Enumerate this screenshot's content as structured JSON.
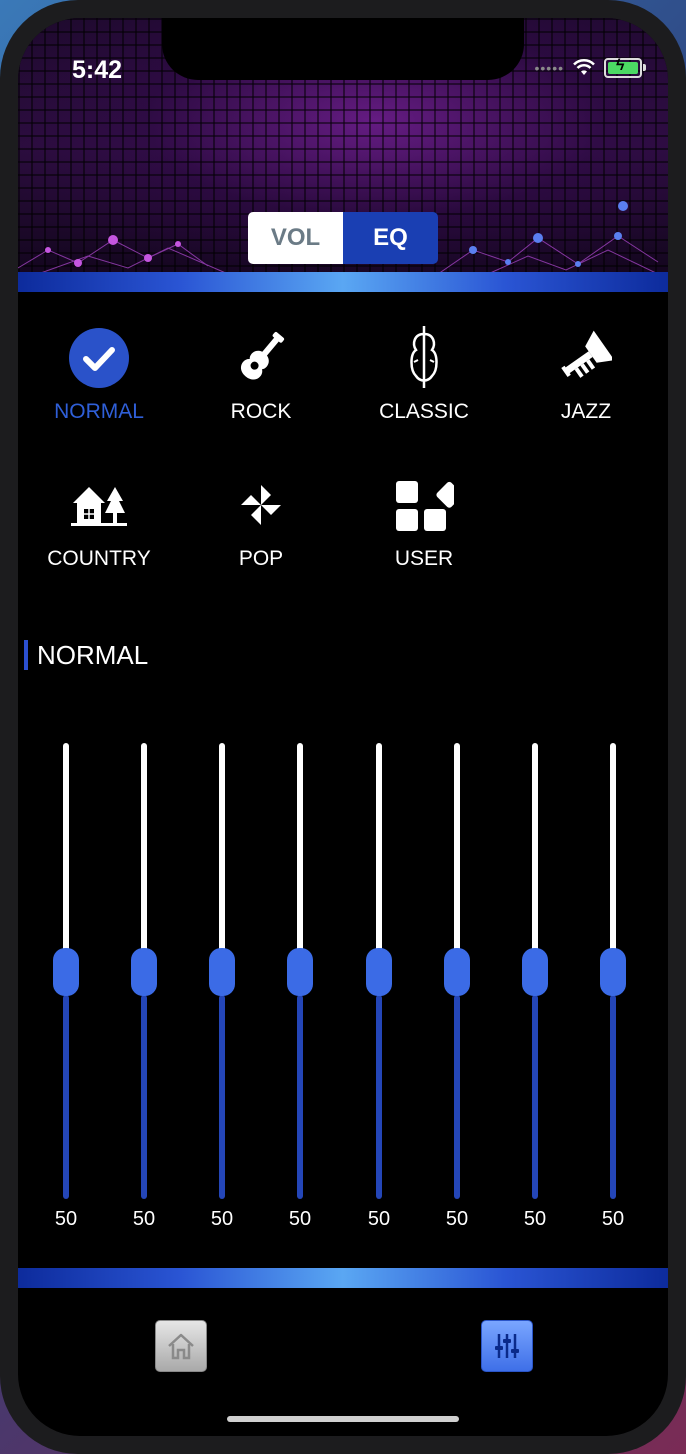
{
  "status": {
    "time": "5:42",
    "signal_dots": "•••••",
    "battery_color": "#4cd964"
  },
  "mode_switch": {
    "vol_label": "VOL",
    "eq_label": "EQ",
    "selected": "EQ"
  },
  "presets": [
    {
      "label": "NORMAL",
      "icon": "check-circle-icon",
      "selected": true
    },
    {
      "label": "ROCK",
      "icon": "guitar-icon",
      "selected": false
    },
    {
      "label": "CLASSIC",
      "icon": "violin-icon",
      "selected": false
    },
    {
      "label": "JAZZ",
      "icon": "trumpet-icon",
      "selected": false
    },
    {
      "label": "COUNTRY",
      "icon": "house-trees-icon",
      "selected": false
    },
    {
      "label": "POP",
      "icon": "pinwheel-icon",
      "selected": false
    },
    {
      "label": "USER",
      "icon": "user-blocks-icon",
      "selected": false
    }
  ],
  "current_preset": {
    "title": "NORMAL"
  },
  "equalizer": {
    "bands": [
      {
        "value": "50",
        "level": 0.5
      },
      {
        "value": "50",
        "level": 0.5
      },
      {
        "value": "50",
        "level": 0.5
      },
      {
        "value": "50",
        "level": 0.5
      },
      {
        "value": "50",
        "level": 0.5
      },
      {
        "value": "50",
        "level": 0.5
      },
      {
        "value": "50",
        "level": 0.5
      },
      {
        "value": "50",
        "level": 0.5
      }
    ]
  },
  "nav": {
    "home_icon": "home-icon",
    "eq_icon": "sliders-icon",
    "active": "eq"
  },
  "colors": {
    "accent": "#2f5fd8",
    "track_active": "#2446b8",
    "thumb": "#3b6be6"
  }
}
